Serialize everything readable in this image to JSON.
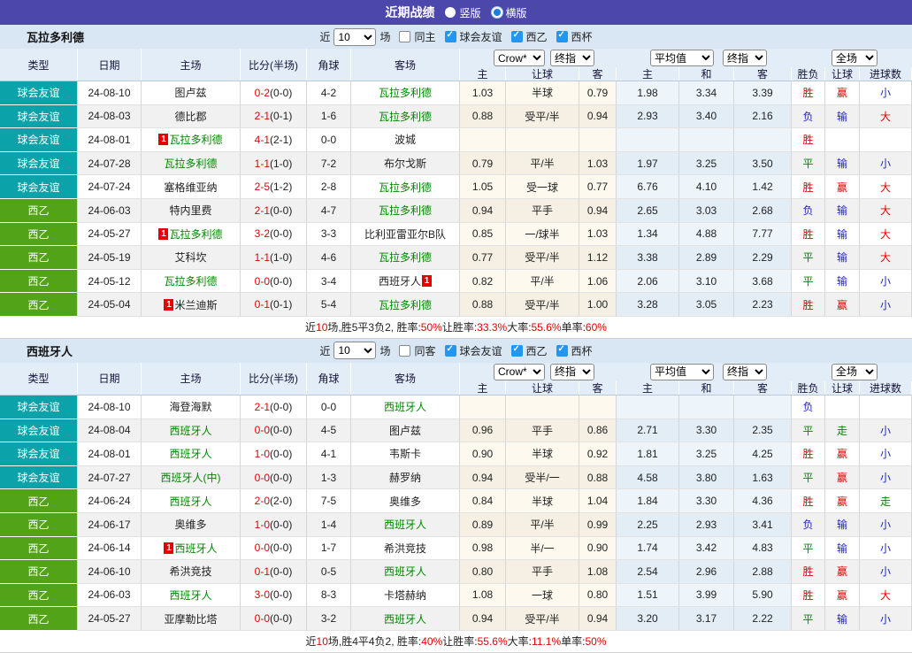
{
  "topbar": {
    "title": "近期战绩",
    "radios": [
      {
        "label": "竖版",
        "selected": false
      },
      {
        "label": "横版",
        "selected": true
      }
    ]
  },
  "badge_text": "1",
  "colors": {
    "accent_purple": "#4b47ab",
    "league_teal": "#0ba3a9",
    "league_green": "#52a318",
    "team_green": "#008800",
    "win_red": "#e60000",
    "lose_blue": "#2222cc"
  },
  "sections": [
    {
      "team": "瓦拉多利德",
      "filter": {
        "near_label": "近",
        "count": "10",
        "games_label": "场",
        "same_label": "同主",
        "same_checked": false,
        "leagues": [
          {
            "label": "球会友谊",
            "checked": true
          },
          {
            "label": "西乙",
            "checked": true
          },
          {
            "label": "西杯",
            "checked": true
          }
        ]
      },
      "header": {
        "left_cols": [
          "类型",
          "日期",
          "主场",
          "比分(半场)",
          "角球",
          "客场"
        ],
        "dropdowns": [
          "Crow*",
          "终指",
          "平均值",
          "终指",
          "全场"
        ],
        "sub_cols": [
          "主",
          "让球",
          "客",
          "主",
          "和",
          "客",
          "胜负",
          "让球",
          "进球数"
        ]
      },
      "rows": [
        {
          "lg": "球会友谊",
          "lgc": "teal",
          "date": "24-08-10",
          "home": "图卢兹",
          "hg": false,
          "hb": false,
          "score": "0-2",
          "half": "(0-0)",
          "corner": "4-2",
          "away": "瓦拉多利德",
          "ag": true,
          "ab": false,
          "o1": "1.03",
          "o2": "半球",
          "o3": "0.79",
          "a1": "1.98",
          "a2": "3.34",
          "a3": "3.39",
          "res": "胜",
          "resc": "r",
          "hc": "赢",
          "hcc": "r",
          "gl": "小",
          "glc": "b"
        },
        {
          "lg": "球会友谊",
          "lgc": "teal",
          "date": "24-08-03",
          "home": "德比郡",
          "hg": false,
          "hb": false,
          "score": "2-1",
          "half": "(0-1)",
          "corner": "1-6",
          "away": "瓦拉多利德",
          "ag": true,
          "ab": false,
          "o1": "0.88",
          "o2": "受平/半",
          "o3": "0.94",
          "a1": "2.93",
          "a2": "3.40",
          "a3": "2.16",
          "res": "负",
          "resc": "b",
          "hc": "输",
          "hcc": "b",
          "gl": "大",
          "glc": "r"
        },
        {
          "lg": "球会友谊",
          "lgc": "teal",
          "date": "24-08-01",
          "home": "瓦拉多利德",
          "hg": true,
          "hb": true,
          "score": "4-1",
          "half": "(2-1)",
          "corner": "0-0",
          "away": "波城",
          "ag": false,
          "ab": false,
          "o1": "",
          "o2": "",
          "o3": "",
          "a1": "",
          "a2": "",
          "a3": "",
          "res": "胜",
          "resc": "r",
          "hc": "",
          "hcc": "",
          "gl": "",
          "glc": ""
        },
        {
          "lg": "球会友谊",
          "lgc": "teal",
          "date": "24-07-28",
          "home": "瓦拉多利德",
          "hg": true,
          "hb": false,
          "score": "1-1",
          "half": "(1-0)",
          "corner": "7-2",
          "away": "布尔戈斯",
          "ag": false,
          "ab": false,
          "o1": "0.79",
          "o2": "平/半",
          "o3": "1.03",
          "a1": "1.97",
          "a2": "3.25",
          "a3": "3.50",
          "res": "平",
          "resc": "g",
          "hc": "输",
          "hcc": "b",
          "gl": "小",
          "glc": "b"
        },
        {
          "lg": "球会友谊",
          "lgc": "teal",
          "date": "24-07-24",
          "home": "塞格维亚纳",
          "hg": false,
          "hb": false,
          "score": "2-5",
          "half": "(1-2)",
          "corner": "2-8",
          "away": "瓦拉多利德",
          "ag": true,
          "ab": false,
          "o1": "1.05",
          "o2": "受一球",
          "o3": "0.77",
          "a1": "6.76",
          "a2": "4.10",
          "a3": "1.42",
          "res": "胜",
          "resc": "r",
          "hc": "赢",
          "hcc": "r",
          "gl": "大",
          "glc": "r"
        },
        {
          "lg": "西乙",
          "lgc": "green",
          "date": "24-06-03",
          "home": "特内里费",
          "hg": false,
          "hb": false,
          "score": "2-1",
          "half": "(0-0)",
          "corner": "4-7",
          "away": "瓦拉多利德",
          "ag": true,
          "ab": false,
          "o1": "0.94",
          "o2": "平手",
          "o3": "0.94",
          "a1": "2.65",
          "a2": "3.03",
          "a3": "2.68",
          "res": "负",
          "resc": "b",
          "hc": "输",
          "hcc": "b",
          "gl": "大",
          "glc": "r"
        },
        {
          "lg": "西乙",
          "lgc": "green",
          "date": "24-05-27",
          "home": "瓦拉多利德",
          "hg": true,
          "hb": true,
          "score": "3-2",
          "half": "(0-0)",
          "corner": "3-3",
          "away": "比利亚雷亚尔B队",
          "ag": false,
          "ab": false,
          "o1": "0.85",
          "o2": "一/球半",
          "o3": "1.03",
          "a1": "1.34",
          "a2": "4.88",
          "a3": "7.77",
          "res": "胜",
          "resc": "r",
          "hc": "输",
          "hcc": "b",
          "gl": "大",
          "glc": "r"
        },
        {
          "lg": "西乙",
          "lgc": "green",
          "date": "24-05-19",
          "home": "艾科坎",
          "hg": false,
          "hb": false,
          "score": "1-1",
          "half": "(1-0)",
          "corner": "4-6",
          "away": "瓦拉多利德",
          "ag": true,
          "ab": false,
          "o1": "0.77",
          "o2": "受平/半",
          "o3": "1.12",
          "a1": "3.38",
          "a2": "2.89",
          "a3": "2.29",
          "res": "平",
          "resc": "g",
          "hc": "输",
          "hcc": "b",
          "gl": "大",
          "glc": "r"
        },
        {
          "lg": "西乙",
          "lgc": "green",
          "date": "24-05-12",
          "home": "瓦拉多利德",
          "hg": true,
          "hb": false,
          "score": "0-0",
          "half": "(0-0)",
          "corner": "3-4",
          "away": "西班牙人",
          "ag": false,
          "ab": true,
          "o1": "0.82",
          "o2": "平/半",
          "o3": "1.06",
          "a1": "2.06",
          "a2": "3.10",
          "a3": "3.68",
          "res": "平",
          "resc": "g",
          "hc": "输",
          "hcc": "b",
          "gl": "小",
          "glc": "b"
        },
        {
          "lg": "西乙",
          "lgc": "green",
          "date": "24-05-04",
          "home": "米兰迪斯",
          "hg": false,
          "hb": true,
          "score": "0-1",
          "half": "(0-1)",
          "corner": "5-4",
          "away": "瓦拉多利德",
          "ag": true,
          "ab": false,
          "o1": "0.88",
          "o2": "受平/半",
          "o3": "1.00",
          "a1": "3.28",
          "a2": "3.05",
          "a3": "2.23",
          "res": "胜",
          "resc": "r",
          "hc": "赢",
          "hcc": "r",
          "gl": "小",
          "glc": "b"
        }
      ],
      "summary": [
        {
          "t": "近"
        },
        {
          "t": "10",
          "r": true
        },
        {
          "t": "场,胜5平3负2, 胜率:"
        },
        {
          "t": "50%",
          "r": true
        },
        {
          "t": " 让胜率:"
        },
        {
          "t": "33.3%",
          "r": true
        },
        {
          "t": " 大率:"
        },
        {
          "t": "55.6%",
          "r": true
        },
        {
          "t": " 单率:"
        },
        {
          "t": "60%",
          "r": true
        }
      ]
    },
    {
      "team": "西班牙人",
      "filter": {
        "near_label": "近",
        "count": "10",
        "games_label": "场",
        "same_label": "同客",
        "same_checked": false,
        "leagues": [
          {
            "label": "球会友谊",
            "checked": true
          },
          {
            "label": "西乙",
            "checked": true
          },
          {
            "label": "西杯",
            "checked": true
          }
        ]
      },
      "header": {
        "left_cols": [
          "类型",
          "日期",
          "主场",
          "比分(半场)",
          "角球",
          "客场"
        ],
        "dropdowns": [
          "Crow*",
          "终指",
          "平均值",
          "终指",
          "全场"
        ],
        "sub_cols": [
          "主",
          "让球",
          "客",
          "主",
          "和",
          "客",
          "胜负",
          "让球",
          "进球数"
        ]
      },
      "rows": [
        {
          "lg": "球会友谊",
          "lgc": "teal",
          "date": "24-08-10",
          "home": "海登海默",
          "hg": false,
          "hb": false,
          "score": "2-1",
          "half": "(0-0)",
          "corner": "0-0",
          "away": "西班牙人",
          "ag": true,
          "ab": false,
          "o1": "",
          "o2": "",
          "o3": "",
          "a1": "",
          "a2": "",
          "a3": "",
          "res": "负",
          "resc": "b",
          "hc": "",
          "hcc": "",
          "gl": "",
          "glc": ""
        },
        {
          "lg": "球会友谊",
          "lgc": "teal",
          "date": "24-08-04",
          "home": "西班牙人",
          "hg": true,
          "hb": false,
          "score": "0-0",
          "half": "(0-0)",
          "corner": "4-5",
          "away": "图卢兹",
          "ag": false,
          "ab": false,
          "o1": "0.96",
          "o2": "平手",
          "o3": "0.86",
          "a1": "2.71",
          "a2": "3.30",
          "a3": "2.35",
          "res": "平",
          "resc": "g",
          "hc": "走",
          "hcc": "g",
          "gl": "小",
          "glc": "b"
        },
        {
          "lg": "球会友谊",
          "lgc": "teal",
          "date": "24-08-01",
          "home": "西班牙人",
          "hg": true,
          "hb": false,
          "score": "1-0",
          "half": "(0-0)",
          "corner": "4-1",
          "away": "韦斯卡",
          "ag": false,
          "ab": false,
          "o1": "0.90",
          "o2": "半球",
          "o3": "0.92",
          "a1": "1.81",
          "a2": "3.25",
          "a3": "4.25",
          "res": "胜",
          "resc": "r",
          "hc": "赢",
          "hcc": "r",
          "gl": "小",
          "glc": "b"
        },
        {
          "lg": "球会友谊",
          "lgc": "teal",
          "date": "24-07-27",
          "home": "西班牙人(中)",
          "hg": true,
          "hb": false,
          "score": "0-0",
          "half": "(0-0)",
          "corner": "1-3",
          "away": "赫罗纳",
          "ag": false,
          "ab": false,
          "o1": "0.94",
          "o2": "受半/一",
          "o3": "0.88",
          "a1": "4.58",
          "a2": "3.80",
          "a3": "1.63",
          "res": "平",
          "resc": "g",
          "hc": "赢",
          "hcc": "r",
          "gl": "小",
          "glc": "b"
        },
        {
          "lg": "西乙",
          "lgc": "green",
          "date": "24-06-24",
          "home": "西班牙人",
          "hg": true,
          "hb": false,
          "score": "2-0",
          "half": "(2-0)",
          "corner": "7-5",
          "away": "奥维多",
          "ag": false,
          "ab": false,
          "o1": "0.84",
          "o2": "半球",
          "o3": "1.04",
          "a1": "1.84",
          "a2": "3.30",
          "a3": "4.36",
          "res": "胜",
          "resc": "r",
          "hc": "赢",
          "hcc": "r",
          "gl": "走",
          "glc": "g"
        },
        {
          "lg": "西乙",
          "lgc": "green",
          "date": "24-06-17",
          "home": "奥维多",
          "hg": false,
          "hb": false,
          "score": "1-0",
          "half": "(0-0)",
          "corner": "1-4",
          "away": "西班牙人",
          "ag": true,
          "ab": false,
          "o1": "0.89",
          "o2": "平/半",
          "o3": "0.99",
          "a1": "2.25",
          "a2": "2.93",
          "a3": "3.41",
          "res": "负",
          "resc": "b",
          "hc": "输",
          "hcc": "b",
          "gl": "小",
          "glc": "b"
        },
        {
          "lg": "西乙",
          "lgc": "green",
          "date": "24-06-14",
          "home": "西班牙人",
          "hg": true,
          "hb": true,
          "score": "0-0",
          "half": "(0-0)",
          "corner": "1-7",
          "away": "希洪竞技",
          "ag": false,
          "ab": false,
          "o1": "0.98",
          "o2": "半/一",
          "o3": "0.90",
          "a1": "1.74",
          "a2": "3.42",
          "a3": "4.83",
          "res": "平",
          "resc": "g",
          "hc": "输",
          "hcc": "b",
          "gl": "小",
          "glc": "b"
        },
        {
          "lg": "西乙",
          "lgc": "green",
          "date": "24-06-10",
          "home": "希洪竞技",
          "hg": false,
          "hb": false,
          "score": "0-1",
          "half": "(0-0)",
          "corner": "0-5",
          "away": "西班牙人",
          "ag": true,
          "ab": false,
          "o1": "0.80",
          "o2": "平手",
          "o3": "1.08",
          "a1": "2.54",
          "a2": "2.96",
          "a3": "2.88",
          "res": "胜",
          "resc": "r",
          "hc": "赢",
          "hcc": "r",
          "gl": "小",
          "glc": "b"
        },
        {
          "lg": "西乙",
          "lgc": "green",
          "date": "24-06-03",
          "home": "西班牙人",
          "hg": true,
          "hb": false,
          "score": "3-0",
          "half": "(0-0)",
          "corner": "8-3",
          "away": "卡塔赫纳",
          "ag": false,
          "ab": false,
          "o1": "1.08",
          "o2": "一球",
          "o3": "0.80",
          "a1": "1.51",
          "a2": "3.99",
          "a3": "5.90",
          "res": "胜",
          "resc": "r",
          "hc": "赢",
          "hcc": "r",
          "gl": "大",
          "glc": "r"
        },
        {
          "lg": "西乙",
          "lgc": "green",
          "date": "24-05-27",
          "home": "亚摩勒比塔",
          "hg": false,
          "hb": false,
          "score": "0-0",
          "half": "(0-0)",
          "corner": "3-2",
          "away": "西班牙人",
          "ag": true,
          "ab": false,
          "o1": "0.94",
          "o2": "受平/半",
          "o3": "0.94",
          "a1": "3.20",
          "a2": "3.17",
          "a3": "2.22",
          "res": "平",
          "resc": "g",
          "hc": "输",
          "hcc": "b",
          "gl": "小",
          "glc": "b"
        }
      ],
      "summary": [
        {
          "t": "近"
        },
        {
          "t": "10",
          "r": true
        },
        {
          "t": "场,胜4平4负2, 胜率:"
        },
        {
          "t": "40%",
          "r": true
        },
        {
          "t": " 让胜率:"
        },
        {
          "t": "55.6%",
          "r": true
        },
        {
          "t": " 大率:"
        },
        {
          "t": "11.1%",
          "r": true
        },
        {
          "t": " 单率:"
        },
        {
          "t": "50%",
          "r": true
        }
      ]
    }
  ]
}
